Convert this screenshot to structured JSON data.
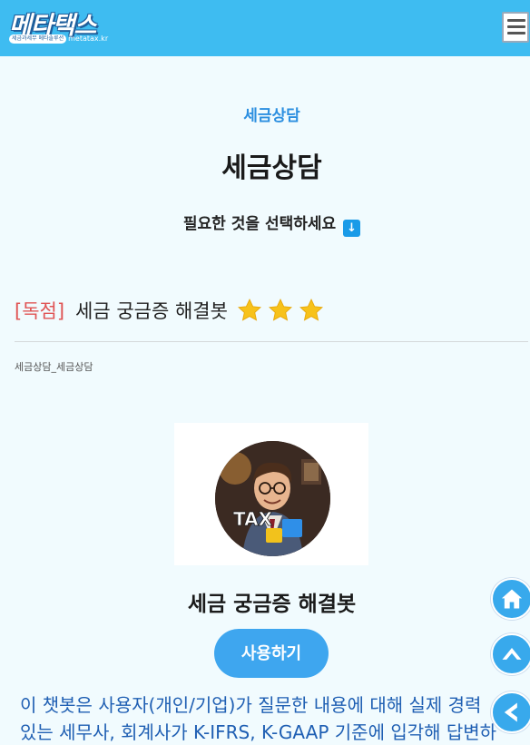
{
  "header": {
    "logo_text": "메타택스",
    "logo_tagline": "세금과세무 메타솔루션",
    "logo_domain": "metatax.kr",
    "menu_icon": "hamburger-menu-icon"
  },
  "hero": {
    "eyebrow": "세금상담",
    "title": "세금상담",
    "instruction": "필요한 것을 선택하세요"
  },
  "post": {
    "tag": "[독점]",
    "title": "세금 궁금증 해결봇",
    "star_icons": [
      "star-icon",
      "star-icon",
      "star-icon"
    ],
    "category": "세금상담_세금상담"
  },
  "bot": {
    "avatar_badge": "TAX",
    "name": "세금 궁금증 해결봇",
    "use_button": "사용하기",
    "description_line1": "이 챗봇은 사용자(개인/기업)가 질문한 내용에 대해 실제 경력",
    "description_line2": "있는 세무사, 회계사가 K-IFRS, K-GAAP 기준에 입각해 답변하"
  },
  "floating": {
    "home_icon": "home-icon",
    "top_icon": "chevron-up-icon",
    "back_icon": "chevron-left-icon"
  },
  "colors": {
    "header_bg": "#3ebcf1",
    "accent_blue": "#2c8fe0",
    "tag_red": "#e05454",
    "button_blue": "#3ea6ef"
  }
}
